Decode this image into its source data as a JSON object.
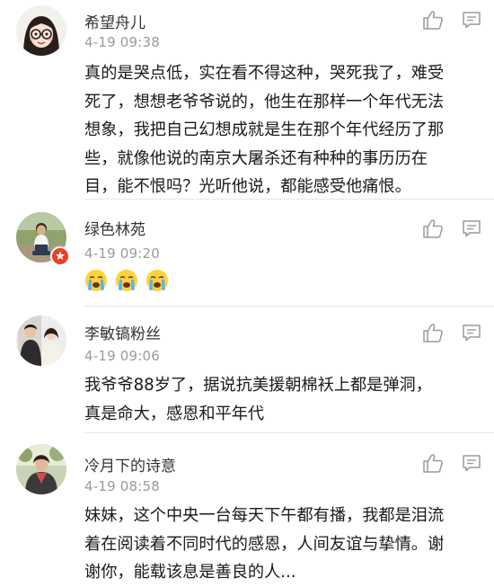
{
  "comments": [
    {
      "username": "希望舟儿",
      "time": "4-19 09:38",
      "lines": [
        "真的是哭点低，实在看不得这种，哭死我了，难受",
        "死了，想想老爷爷说的，他生在那样一个年代无法",
        "想象，我把自己幻想成就是生在那个年代经历了那",
        "些，就像他说的南京大屠杀还有种种的事历历在",
        "目，能不恨吗？光听他说，都能感受他痛恨。"
      ],
      "avatar": "cartoon-girl-with-glasses-avatar"
    },
    {
      "username": "绿色林苑",
      "time": "4-19 09:20",
      "emoji": [
        "crying-face-emoji",
        "crying-face-emoji",
        "crying-face-emoji"
      ],
      "avatar": "photo-person-sitting-outdoors-avatar",
      "badge": "verified-badge"
    },
    {
      "username": "李敏镐粉丝",
      "time": "4-19 09:06",
      "lines": [
        "我爷爷88岁了，据说抗美援朝棉袄上都是弹洞，",
        "真是命大，感恩和平年代"
      ],
      "avatar": "photo-couple-avatar"
    },
    {
      "username": "冷月下的诗意",
      "time": "4-19 08:58",
      "lines": [
        "妹妹，这个中央一台每天下午都有播，我都是泪流",
        "着在阅读着不同时代的感恩，人间友谊与挚情。谢",
        "谢你，能载该息是善良的人..."
      ],
      "avatar": "photo-woman-outdoors-avatar"
    }
  ],
  "colors": {
    "text": "#1a1a1a",
    "username": "#333333",
    "time": "#9a9a9a",
    "icon": "#9a9a9a",
    "divider": "#e6e6e6"
  }
}
